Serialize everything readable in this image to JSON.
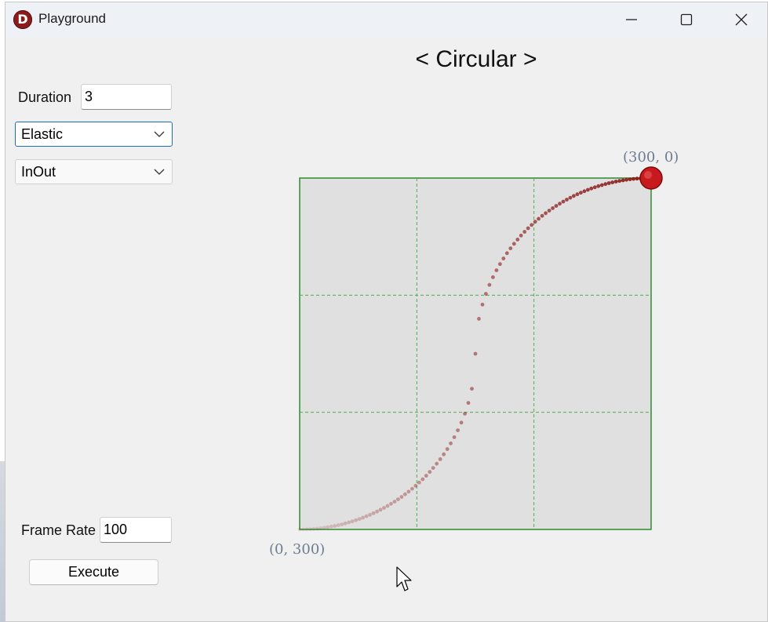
{
  "window": {
    "title": "Playground",
    "app_icon_letter": "D",
    "controls": [
      "minimize",
      "maximize",
      "close"
    ]
  },
  "form": {
    "duration_label": "Duration",
    "duration_value": "3",
    "easing_type": "Elastic",
    "easing_mode": "InOut",
    "frame_rate_label": "Frame Rate",
    "frame_rate_value": "100",
    "execute_label": "Execute"
  },
  "canvas": {
    "heading": "< Circular >",
    "top_right_label": "(300, 0)",
    "bottom_left_label": "(0, 300)",
    "grid_divisions": 3,
    "colors": {
      "plot_background": "#e0e0e0",
      "border": "#2e8b2e",
      "grid": "#4caf50",
      "dot": "#8b1a1a",
      "ball": "#c8191e"
    }
  }
}
